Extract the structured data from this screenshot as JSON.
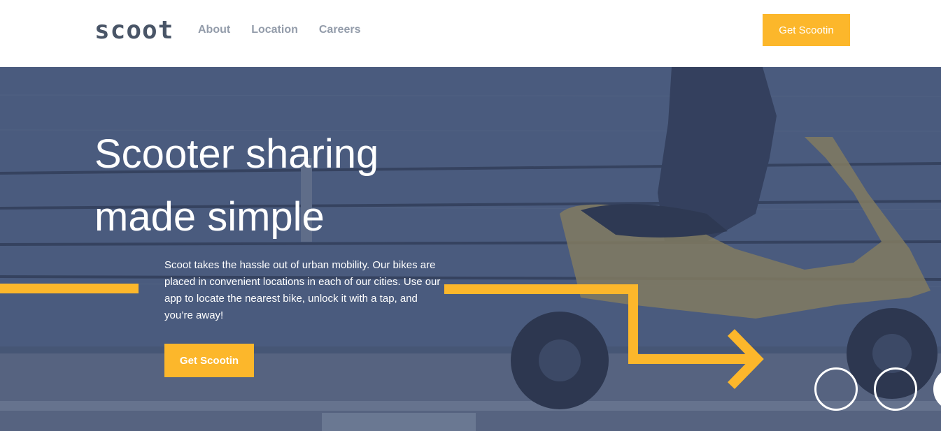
{
  "header": {
    "logo": "scoot",
    "nav": [
      "About",
      "Location",
      "Careers"
    ],
    "cta_label": "Get Scootin"
  },
  "hero": {
    "title_line1": "Scooter sharing",
    "title_line2": "made simple",
    "description": "Scoot takes the hassle out of urban mobility. Our bikes are placed in convenient locations in each of our cities. Use our app to locate the nearest bike, unlock it with a tap, and you’re away!",
    "cta_label": "Get Scootin"
  },
  "colors": {
    "accent": "#fcb72b",
    "hero_overlay": "#4a5a78",
    "nav_text": "#939caa",
    "logo": "#495567"
  },
  "icons": {
    "decorative_line": "pattern-line",
    "arrow": "right-arrow-decoration",
    "circles": "circle-decoration"
  }
}
